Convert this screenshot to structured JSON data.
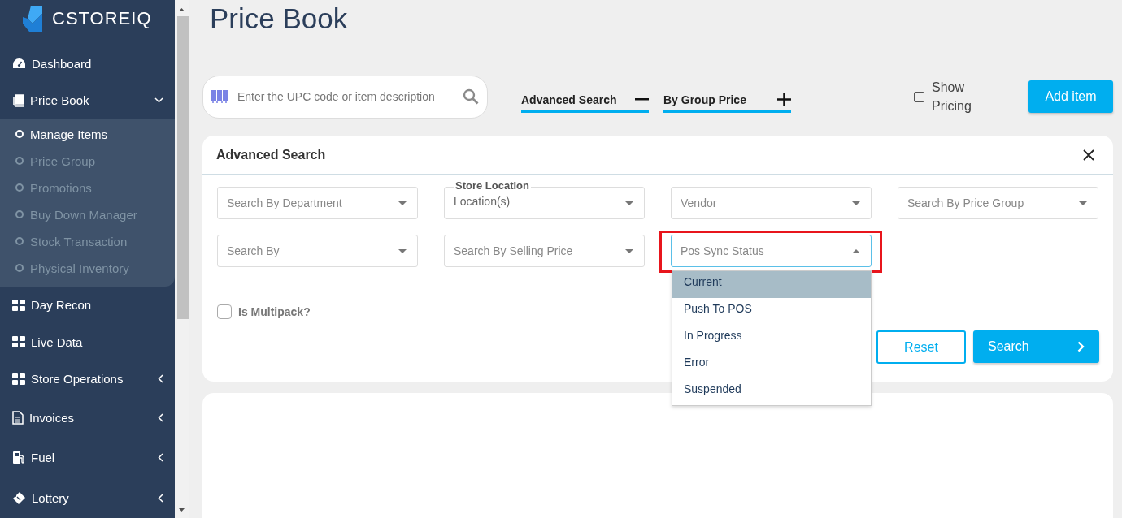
{
  "sidebar": {
    "logo": "CSTOREIQ",
    "items": [
      {
        "label": "Dashboard"
      },
      {
        "label": "Price Book",
        "expanded": true,
        "children": [
          {
            "label": "Manage Items",
            "selected": true
          },
          {
            "label": "Price Group",
            "selected": false
          },
          {
            "label": "Promotions",
            "selected": false
          },
          {
            "label": "Buy Down Manager",
            "selected": false
          },
          {
            "label": "Stock Transaction",
            "selected": false
          },
          {
            "label": "Physical Inventory",
            "selected": false
          }
        ]
      },
      {
        "label": "Day Recon"
      },
      {
        "label": "Live Data"
      },
      {
        "label": "Store Operations",
        "expanded": false
      },
      {
        "label": "Invoices",
        "expanded": false
      },
      {
        "label": "Fuel",
        "expanded": false
      },
      {
        "label": "Lottery",
        "expanded": false
      }
    ]
  },
  "page": {
    "title": "Price Book",
    "search": {
      "placeholder": "Enter the UPC code or item description"
    },
    "toggles": [
      {
        "label": "Advanced Search",
        "expanded": true
      },
      {
        "label": "By Group Price",
        "expanded": false
      }
    ],
    "show_pricing": {
      "label": "Show Pricing",
      "checked": false
    },
    "add_button": "Add item"
  },
  "advanced_search": {
    "title": "Advanced Search",
    "filters": [
      {
        "placeholder": "Search By Department",
        "open": false,
        "highlighted": false
      },
      {
        "label": "Store Location",
        "value": "Location(s)",
        "open": false,
        "highlighted": false
      },
      {
        "placeholder": "Vendor",
        "open": false,
        "highlighted": false
      },
      {
        "placeholder": "Search By Price Group",
        "open": false,
        "highlighted": false
      },
      {
        "placeholder": "Search By",
        "open": false,
        "highlighted": false
      },
      {
        "placeholder": "Search By Selling Price",
        "open": false,
        "highlighted": false
      },
      {
        "placeholder": "Pos Sync Status",
        "open": true,
        "highlighted": true,
        "options": [
          {
            "label": "Current",
            "selected": true
          },
          {
            "label": "Push To POS",
            "selected": false
          },
          {
            "label": "In Progress",
            "selected": false
          },
          {
            "label": "Error",
            "selected": false
          },
          {
            "label": "Suspended",
            "selected": false
          }
        ]
      }
    ],
    "multipack": {
      "label": "Is Multipack?",
      "checked": false
    },
    "buttons": [
      "Reset",
      "Search"
    ]
  }
}
